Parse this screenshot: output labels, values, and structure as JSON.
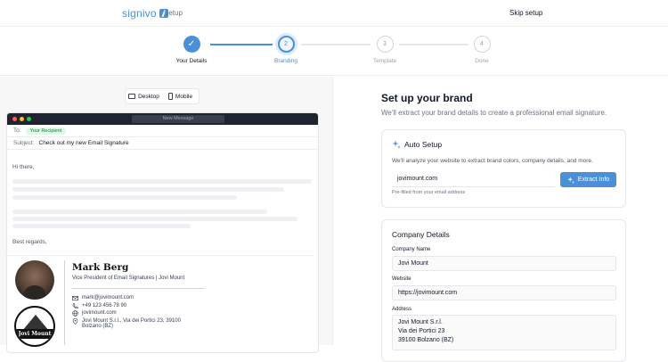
{
  "header": {
    "brand": "signivo",
    "setup": "Setup",
    "skip": "Skip setup"
  },
  "steps": [
    {
      "num": "✓",
      "label": "Your Details",
      "state": "done"
    },
    {
      "num": "2",
      "label": "Branding",
      "state": "active"
    },
    {
      "num": "3",
      "label": "Template",
      "state": "todo"
    },
    {
      "num": "4",
      "label": "Done",
      "state": "todo"
    }
  ],
  "preview": {
    "toggle": {
      "desktop": "Desktop",
      "mobile": "Mobile"
    },
    "window_title": "New Message",
    "to_label": "To:",
    "recipient": "Your Recipient",
    "subject_label": "Subject:",
    "subject": "Check out my new Email Signature",
    "greeting": "Hi there,",
    "closing": "Best regards,"
  },
  "signature": {
    "name": "Mark Berg",
    "title": "Vice President of Email Signatures | Jovi Mount",
    "email": "mark@jovimount.com",
    "phone": "+49 123 456 78 90",
    "website": "jovimount.com",
    "address_1": "Jovi Mount S.r.l., Via dei Portici 23, 39100",
    "address_2": "Bolzano (BZ)",
    "logo_text": "Jovi Mount"
  },
  "brand": {
    "heading": "Set up your brand",
    "subheading": "We'll extract your brand details to create a professional email signature.",
    "auto": {
      "title": "Auto Setup",
      "desc": "We'll analyze your website to extract brand colors, company details, and more.",
      "url_value": "jovimount.com",
      "hint": "Pre-filled from your email address",
      "button": "Extract Info"
    },
    "company": {
      "title": "Company Details",
      "name_label": "Company Name",
      "name_value": "Jovi Mount",
      "website_label": "Website",
      "website_value": "https://jovimount.com",
      "address_label": "Address",
      "address_1": "Jovi Mount S.r.l.",
      "address_2": "Via dei Portici 23",
      "address_3": "39100 Bolzano (BZ)"
    }
  },
  "colors": {
    "accent": "#4a90d9",
    "dark_bar": "#1f2430"
  }
}
